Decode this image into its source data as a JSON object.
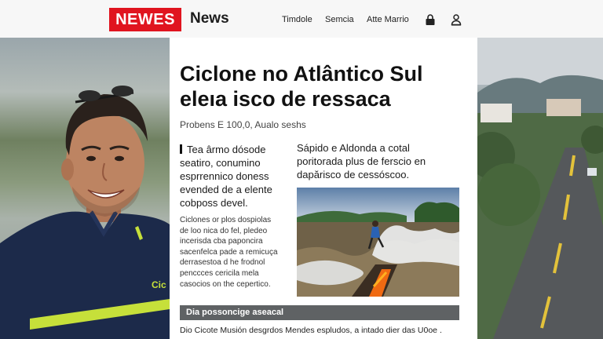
{
  "header": {
    "logo_box": "NEWES",
    "logo_word": "News",
    "nav": [
      "Timdole",
      "Semcia",
      "Atte Marrio"
    ],
    "icons": [
      "lock-icon",
      "user-icon"
    ]
  },
  "person": {
    "shirt_text": "Cic"
  },
  "article": {
    "headline_line1": "Ciclone no Atlântico Sul",
    "headline_line2": "eleıa isco de ressaca",
    "byline": "Probens E 100,0, Aualo seshs",
    "lead_lines": [
      "Tea ârmo dósode",
      "seatiro, conumino",
      "esprrennico doness",
      "evended de a elente",
      "cobposs devel."
    ],
    "body_lines": [
      "Ciclones or plos dospiolas",
      "de loo nica do fel, pledeo",
      "incerisda cba paponcira",
      "sacenfelca pade a remicuça",
      "derrasestoa d he frodnol",
      "penccces cericila mela",
      "casocios on the cepertico."
    ],
    "side_lines": [
      "Sápido e Aldonda a cotal",
      "poritorada plus de ferscio en",
      "dapăriscο de cessóscοo."
    ],
    "caption": "Dia possoncige aseacal",
    "footer": "Dio Cicote Musión desgrdos Mendes espludos, a intado dier das U0oe ."
  },
  "colors": {
    "brand_red": "#e0141f",
    "caption_bg": "#5f6264",
    "shirt_navy": "#1c2a4a",
    "stripe_lime": "#c6e03a"
  }
}
